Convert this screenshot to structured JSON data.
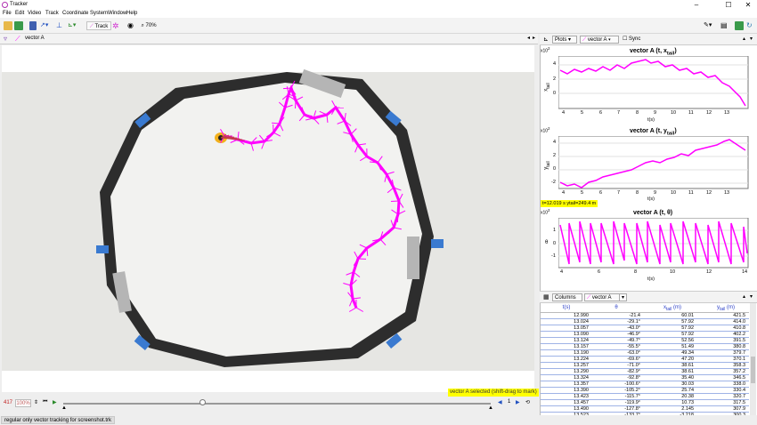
{
  "window": {
    "title": "Tracker",
    "controls": [
      "–",
      "☐",
      "✕"
    ]
  },
  "menu": [
    "File",
    "Edit",
    "Video",
    "Track",
    "Coordinate System",
    "Window",
    "Help"
  ],
  "toolbar": {
    "track_label": "Track",
    "zoom_label": "70%"
  },
  "trackbar": {
    "track_name": "vector A"
  },
  "video": {
    "status": "vector A selected (shift-drag to mark)"
  },
  "player": {
    "frame": "417",
    "rate": "100%",
    "step": "1"
  },
  "statusbar": {
    "filename": "regular only vector tracking for screenshot.trk"
  },
  "plots": {
    "plots_label": "Plots",
    "track_label": "vector A",
    "sync_label": "Sync",
    "items": [
      {
        "title": "vector A (t, x",
        "title_sub": "tail",
        "title_end": ")",
        "multiplier": "x10",
        "mult_exp": "2",
        "ylabel": "x",
        "ylabel_sub": "tail",
        "xlabel": "t(s)",
        "yticks": [
          "4",
          "2",
          "0"
        ],
        "xticks": [
          "4",
          "5",
          "6",
          "7",
          "8",
          "9",
          "10",
          "11",
          "12",
          "13"
        ]
      },
      {
        "title": "vector A (t, y",
        "title_sub": "tail",
        "title_end": ")",
        "multiplier": "x10",
        "mult_exp": "2",
        "ylabel": "y",
        "ylabel_sub": "tail",
        "xlabel": "t(s)",
        "yticks": [
          "4",
          "2",
          "0",
          "-2"
        ],
        "xticks": [
          "4",
          "5",
          "6",
          "7",
          "8",
          "9",
          "10",
          "11",
          "12",
          "13"
        ],
        "readout": "t=12.019 s  ytail=249.4 m"
      },
      {
        "title": "vector A (t, θ)",
        "multiplier": "x10",
        "mult_exp": "2",
        "ylabel": "θ",
        "xlabel": "t(s)",
        "yticks": [
          "1",
          "0",
          "-1"
        ],
        "xticks": [
          "4",
          "6",
          "8",
          "10",
          "12",
          "14"
        ]
      }
    ]
  },
  "table": {
    "columns_label": "Columns",
    "track_label": "vector A",
    "headers": [
      {
        "main": "t(s)",
        "sub": ""
      },
      {
        "main": "θ",
        "sub": ""
      },
      {
        "main": "x",
        "sub": "tail",
        "unit": " (m)"
      },
      {
        "main": "y",
        "sub": "tail",
        "unit": " (m)"
      }
    ],
    "rows": [
      [
        "12.990",
        "-21.4",
        "60.01",
        "421.5"
      ],
      [
        "13.024",
        "-29.1°",
        "57.92",
        "414.0"
      ],
      [
        "13.057",
        "-43.0°",
        "57.92",
        "410.8"
      ],
      [
        "13.090",
        "-46.9°",
        "57.92",
        "402.2"
      ],
      [
        "13.124",
        "-49.7°",
        "52.56",
        "391.5"
      ],
      [
        "13.157",
        "-55.5°",
        "51.49",
        "380.8"
      ],
      [
        "13.190",
        "-63.0°",
        "49.34",
        "379.7"
      ],
      [
        "13.224",
        "-69.6°",
        "47.20",
        "370.1"
      ],
      [
        "13.257",
        "-71.0°",
        "38.61",
        "358.3"
      ],
      [
        "13.290",
        "-82.9°",
        "38.61",
        "357.2"
      ],
      [
        "13.324",
        "-92.8°",
        "35.40",
        "346.5"
      ],
      [
        "13.357",
        "-100.6°",
        "30.03",
        "338.0"
      ],
      [
        "13.390",
        "-105.2°",
        "25.74",
        "330.4"
      ],
      [
        "13.423",
        "-115.7°",
        "20.38",
        "320.7"
      ],
      [
        "13.457",
        "-119.9°",
        "10.73",
        "317.5"
      ],
      [
        "13.490",
        "-127.8°",
        "2.145",
        "307.9"
      ],
      [
        "13.523",
        "-133.7°",
        "-3.218",
        "300.3"
      ]
    ]
  },
  "colors": {
    "track": "#ff00ff",
    "accent": "#2b3fc7",
    "highlight": "#ffff00"
  }
}
